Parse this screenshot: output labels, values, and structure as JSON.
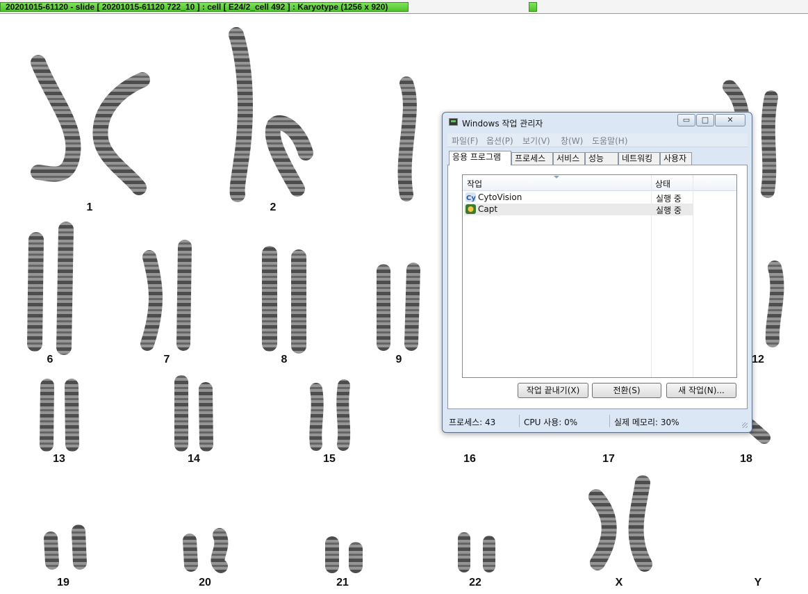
{
  "app_titlebar": {
    "title": "20201015-61120 - slide [ 20201015-61120 722_10 ] : cell [ E24/2_cell 492 ] : Karyotype  (1256 x 920)"
  },
  "karyotype": {
    "labels": [
      "1",
      "2",
      "6",
      "7",
      "8",
      "9",
      "12",
      "13",
      "14",
      "15",
      "16",
      "17",
      "18",
      "19",
      "20",
      "21",
      "22",
      "X",
      "Y"
    ]
  },
  "task_manager": {
    "title": "Windows 작업 관리자",
    "window_buttons": {
      "minimize": "▭",
      "maximize": "□",
      "close": "✕"
    },
    "menu": [
      "파일(F)",
      "옵션(P)",
      "보기(V)",
      "창(W)",
      "도움말(H)"
    ],
    "tabs": [
      "응용 프로그램",
      "프로세스",
      "서비스",
      "성능",
      "네트워킹",
      "사용자"
    ],
    "active_tab": "응용 프로그램",
    "columns": [
      "작업",
      "상태"
    ],
    "rows": [
      {
        "name": "CytoVision",
        "status": "실행 중",
        "icon": "cytovision-icon"
      },
      {
        "name": "Capt",
        "status": "실행 중",
        "icon": "capt-icon"
      }
    ],
    "buttons": [
      "작업 끝내기(X)",
      "전환(S)",
      "새 작업(N)..."
    ],
    "status": {
      "processes": "프로세스: 43",
      "cpu": "CPU 사용: 0%",
      "memory": "실제 메모리: 30%"
    }
  }
}
